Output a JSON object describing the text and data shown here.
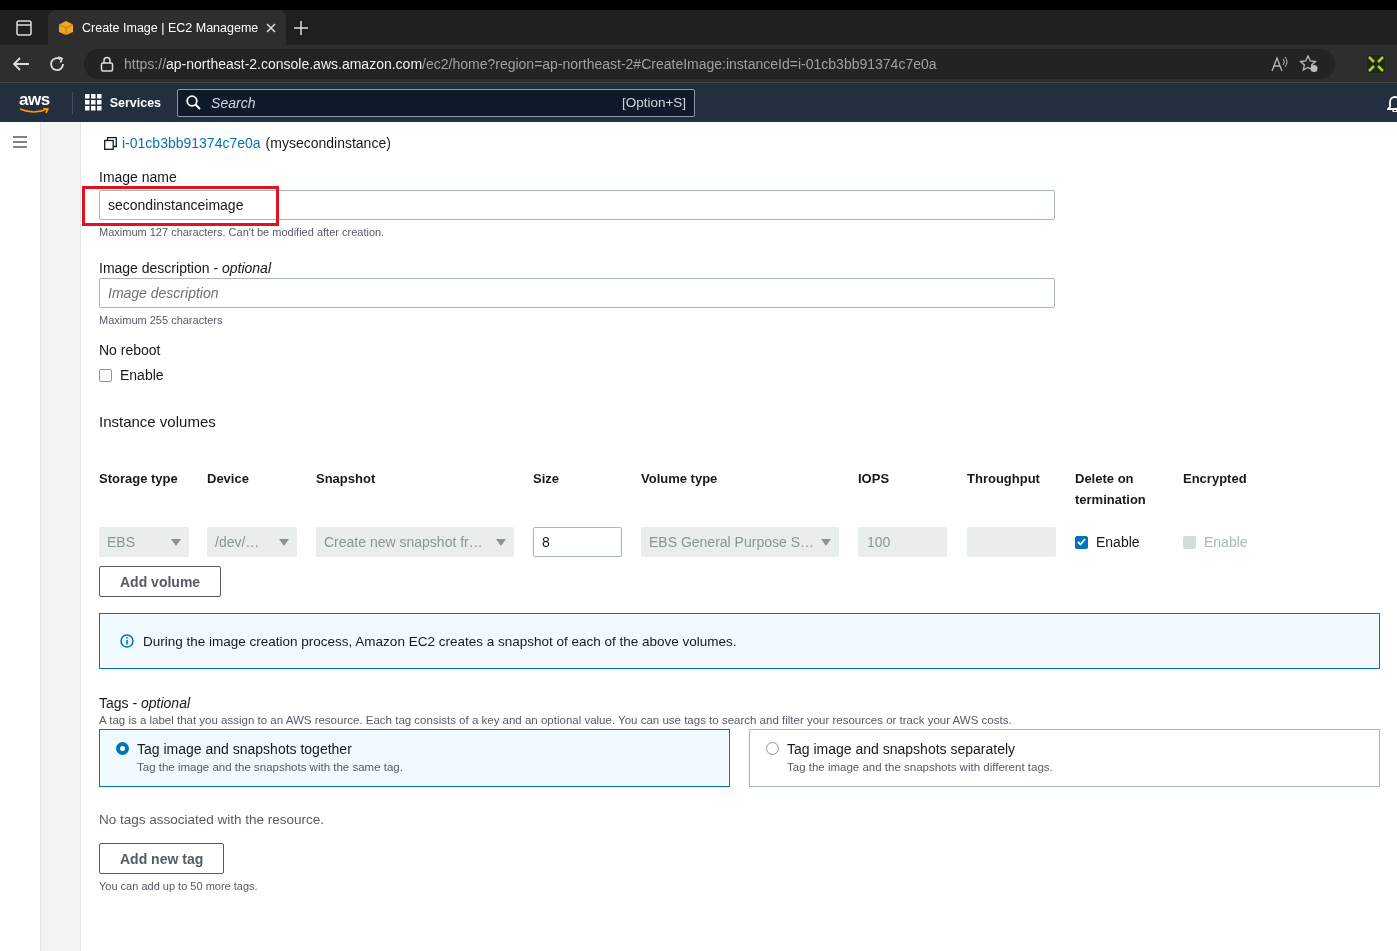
{
  "browser": {
    "tab": {
      "title": "Create Image | EC2 Manageme",
      "selected": true
    },
    "url": {
      "scheme": "https://",
      "host": "ap-northeast-2.console.aws.amazon.com",
      "path": "/ec2/home?region=ap-northeast-2#CreateImage:instanceId=i-01cb3bb91374c7e0a"
    }
  },
  "aws_header": {
    "logo": "aws",
    "services": "Services",
    "search": {
      "placeholder": "Search",
      "shortcut": "[Option+S]"
    }
  },
  "instance": {
    "id": "i-01cb3bb91374c7e0a",
    "name": "(mysecondinstance)"
  },
  "image_name": {
    "label": "Image name",
    "value": "secondinstanceimage",
    "hint": "Maximum 127 characters. Can't be modified after creation.",
    "highlighted": true
  },
  "image_description": {
    "label": "Image description - ",
    "optional": "optional",
    "placeholder": "Image description",
    "hint": "Maximum 255 characters"
  },
  "no_reboot": {
    "label": "No reboot",
    "checkbox": {
      "label": "Enable",
      "checked": false,
      "disabled": false
    }
  },
  "volumes": {
    "title": "Instance volumes",
    "columns": [
      "Storage type",
      "Device",
      "Snapshot",
      "Size",
      "Volume type",
      "IOPS",
      "Throughput",
      "Delete on termination",
      "Encrypted"
    ],
    "rows": [
      [
        {
          "kind": "select",
          "value": "EBS",
          "disabled": true
        },
        {
          "kind": "select",
          "value": "/dev/…",
          "disabled": true
        },
        {
          "kind": "select",
          "value": "Create new snapshot fr…",
          "disabled": true
        },
        {
          "kind": "input",
          "value": "8",
          "disabled": false
        },
        {
          "kind": "select",
          "value": "EBS General Purpose S…",
          "disabled": true
        },
        {
          "kind": "input",
          "value": "100",
          "disabled": true
        },
        {
          "kind": "input",
          "disabled": true
        },
        {
          "kind": "checkbox",
          "label": "Enable",
          "checked": true,
          "disabled": false
        },
        {
          "kind": "checkbox",
          "label": "Enable",
          "checked": false,
          "disabled": true
        }
      ]
    ]
  },
  "add_volume": "Add volume",
  "info": "During the image creation process, Amazon EC2 creates a snapshot of each of the above volumes.",
  "tags": {
    "label": "Tags - ",
    "optional": "optional",
    "description": "A tag is a label that you assign to an AWS resource. Each tag consists of a key and an optional value. You can use tags to search and filter your resources or track your AWS costs.",
    "options": [
      {
        "title": "Tag image and snapshots together",
        "description": "Tag the image and the snapshots with the same tag.",
        "selected": true
      },
      {
        "title": "Tag image and snapshots separately",
        "description": "Tag the image and the snapshots with different tags.",
        "selected": false
      }
    ],
    "empty": "No tags associated with the resource.",
    "add_button": "Add new tag",
    "hint": "You can add up to 50 more tags."
  }
}
